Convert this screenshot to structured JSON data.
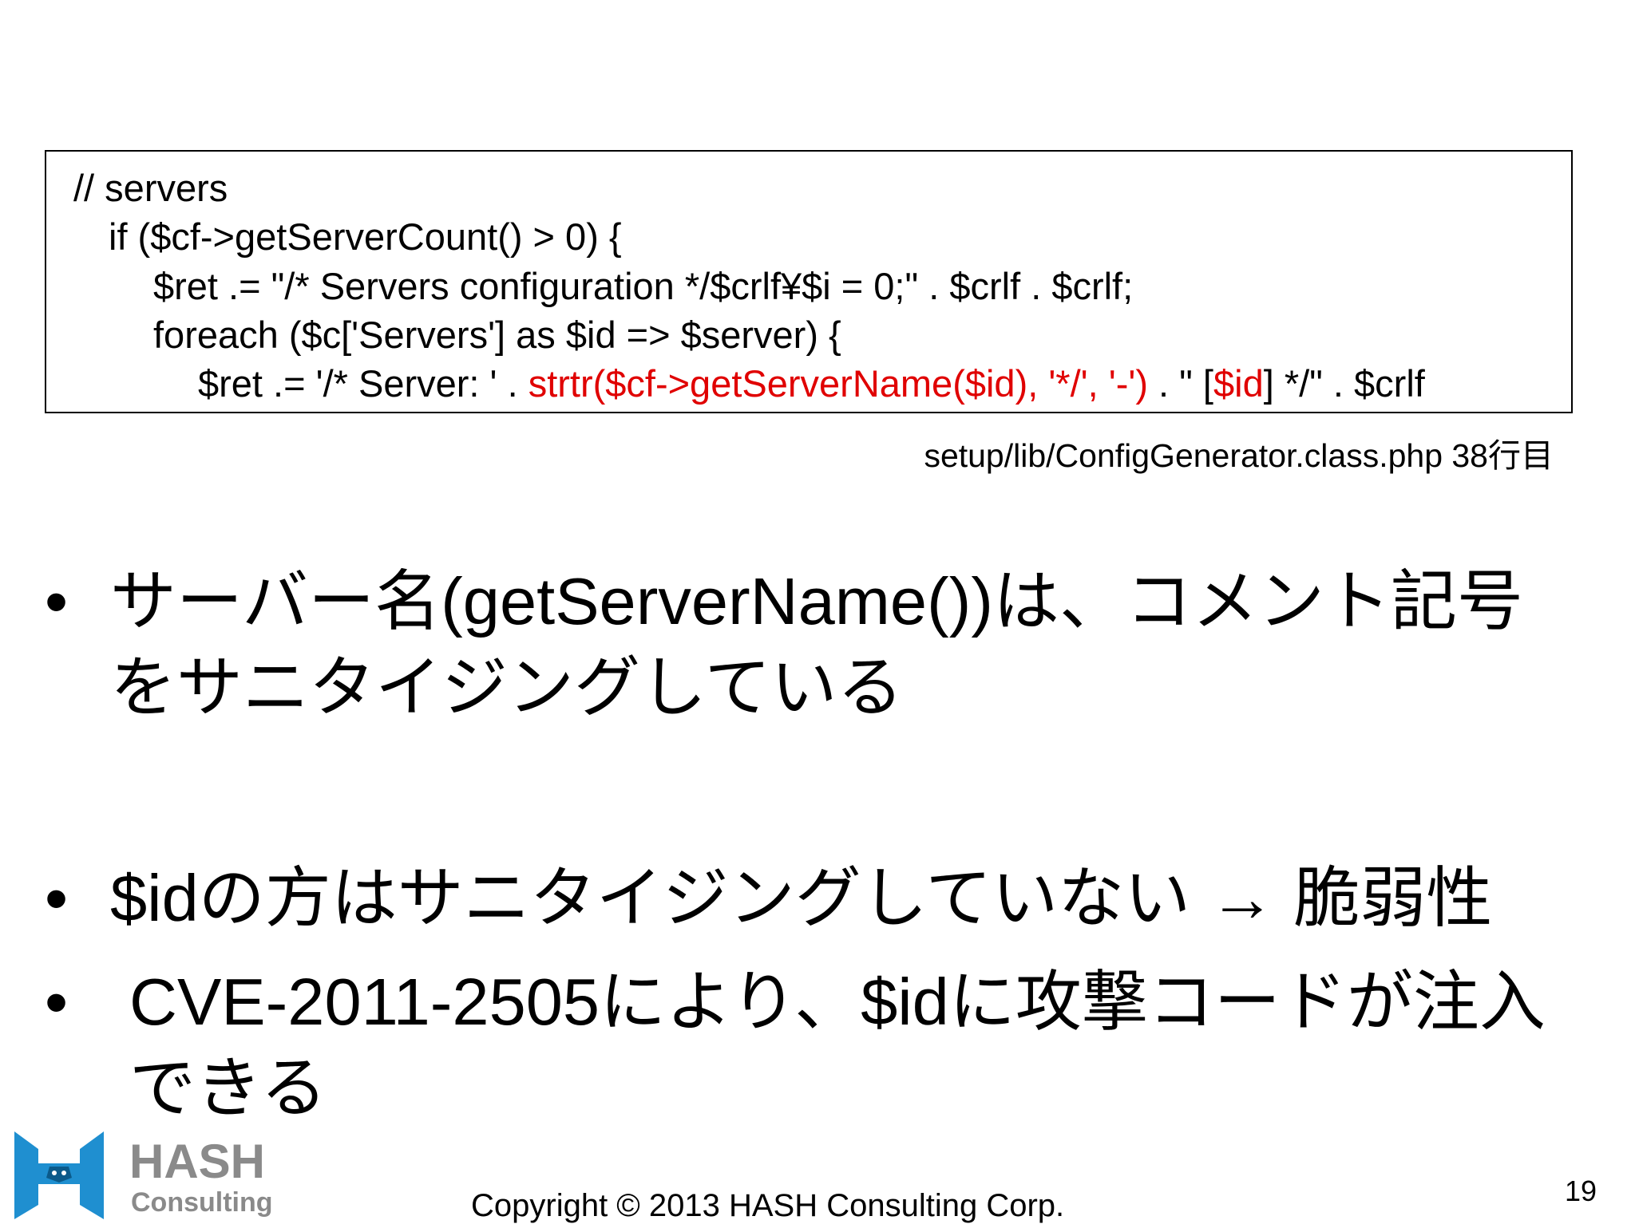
{
  "code": {
    "line1": "// servers",
    "line2": "if ($cf->getServerCount() > 0) {",
    "line3": "$ret .= \"/* Servers configuration */$crlf¥$i = 0;\" . $crlf . $crlf;",
    "line4": "foreach ($c['Servers'] as $id => $server) {",
    "line5": {
      "part1": "$ret .= '/* Server: ' . ",
      "part2": "strtr($cf->getServerName($id), '*/', '-')",
      "part3": " . \" [",
      "part4": "$id",
      "part5": "] */\" . $crlf"
    },
    "highlight_color": "#e00000"
  },
  "caption": "setup/lib/ConfigGenerator.class.php 38行目",
  "bullets": [
    "サーバー名(getServerName())は、コメント記号をサニタイジングしている",
    "$idの方はサニタイジングしていない → 脆弱性",
    " CVE-2011-2505により、$idに攻撃コードが注入できる"
  ],
  "bullet_symbol": "•",
  "logo": {
    "name": "HASH",
    "sub": "Consulting",
    "color": "#1f8fd0",
    "text_color": "#8a8a8a"
  },
  "copyright": "Copyright © 2013 HASH Consulting Corp.",
  "page_number": "19"
}
